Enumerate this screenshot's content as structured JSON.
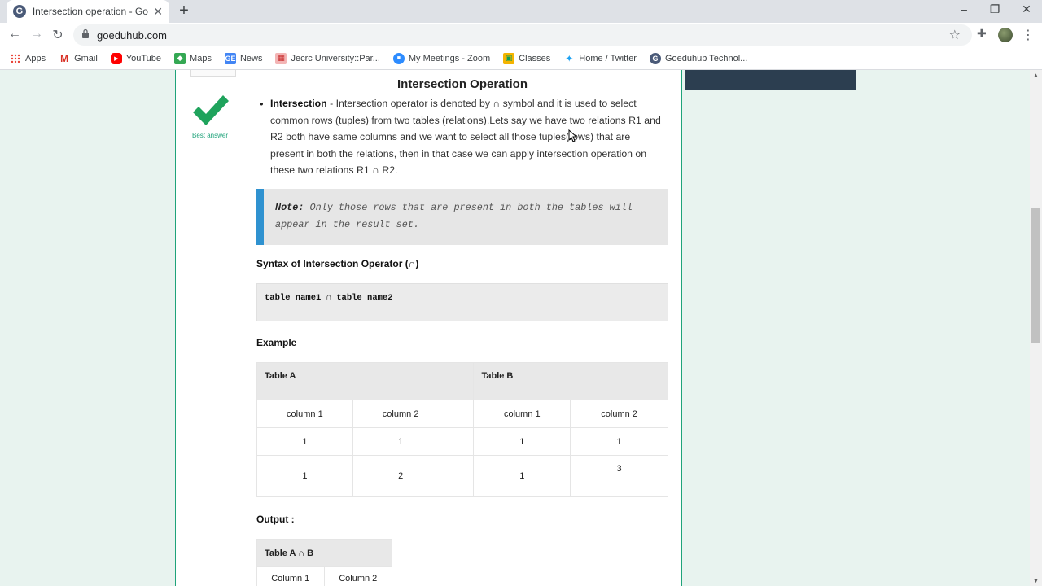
{
  "browser": {
    "tab": {
      "favicon": "G",
      "title": "Intersection operation - Goeduhub"
    },
    "url": "goeduhub.com",
    "bookmarks": [
      {
        "label": "Apps",
        "icon": "apps-grid-icon",
        "color": "#e94235"
      },
      {
        "label": "Gmail",
        "icon": "gmail-icon",
        "color": "#d93025"
      },
      {
        "label": "YouTube",
        "icon": "youtube-icon",
        "color": "#ff0000"
      },
      {
        "label": "Maps",
        "icon": "maps-icon",
        "color": "#34a853"
      },
      {
        "label": "News",
        "icon": "news-icon",
        "color": "#4285f4"
      },
      {
        "label": "Jecrc University::Par...",
        "icon": "jecrc-icon",
        "color": "#e57373"
      },
      {
        "label": "My Meetings - Zoom",
        "icon": "zoom-icon",
        "color": "#2d8cff"
      },
      {
        "label": "Classes",
        "icon": "classes-icon",
        "color": "#f4b400"
      },
      {
        "label": "Home / Twitter",
        "icon": "twitter-icon",
        "color": "#1da1f2"
      },
      {
        "label": "Goeduhub Technol...",
        "icon": "goeduhub-icon",
        "color": "#4a5a78"
      }
    ]
  },
  "answer": {
    "best_label": "Best answer",
    "title": "Intersection Operation",
    "term": "Intersection",
    "description": " - Intersection operator is denoted by ∩ symbol and it is used to select common rows (tuples) from two tables (relations).Lets say we have two relations R1 and R2 both have same columns and we want to select all those tuples(rows) that are present in both the relations, then in that case we can apply intersection operation on these two relations R1 ∩ R2.",
    "note_label": "Note:",
    "note_text": " Only those rows that are present in both the tables will appear in the result set.",
    "syntax_heading": "Syntax of Intersection Operator (∩)",
    "syntax_code": "table_name1 ∩ table_name2",
    "example_heading": "Example",
    "table_a_label": "Table A",
    "table_b_label": "Table B",
    "columns": [
      "column 1",
      "column 2",
      "column 1",
      "column 2"
    ],
    "rows": [
      [
        "1",
        "1",
        "1",
        "1"
      ],
      [
        "1",
        "2",
        "1",
        "3"
      ]
    ],
    "output_heading": "Output :",
    "output_table_label": "Table A ∩ B",
    "output_columns": [
      "Column 1",
      "Column 2"
    ]
  }
}
